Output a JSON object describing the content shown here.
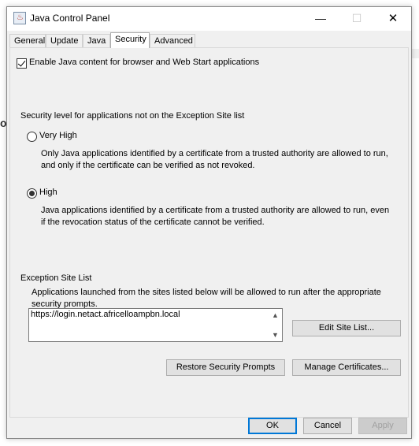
{
  "window": {
    "title": "Java Control Panel"
  },
  "titlebar": {
    "minimize": "—",
    "maximize": "☐",
    "close": "✕"
  },
  "tabs": [
    "General",
    "Update",
    "Java",
    "Security",
    "Advanced"
  ],
  "security": {
    "enable_label": "Enable Java content for browser and Web Start applications",
    "level_heading": "Security level for applications not on the Exception Site list",
    "very_high": {
      "label": "Very High",
      "desc_line1": "Only Java applications identified by a certificate from a trusted authority are allowed to run,",
      "desc_line2": "and only if the certificate can be verified as not revoked."
    },
    "high": {
      "label": "High",
      "desc_line1": "Java applications identified by a certificate from a trusted authority are allowed to run, even",
      "desc_line2": "if the revocation status of the certificate cannot be verified."
    },
    "exception": {
      "heading": "Exception Site List",
      "desc_line1": "Applications launched from the sites listed below will be allowed to run after the appropriate",
      "desc_line2": "security prompts.",
      "sites": [
        "https://login.netact.africelloampbn.local"
      ],
      "edit_button": "Edit Site List..."
    },
    "restore_button": "Restore Security Prompts",
    "manage_button": "Manage Certificates..."
  },
  "footer": {
    "ok": "OK",
    "cancel": "Cancel",
    "apply": "Apply"
  },
  "selected_level": "High"
}
